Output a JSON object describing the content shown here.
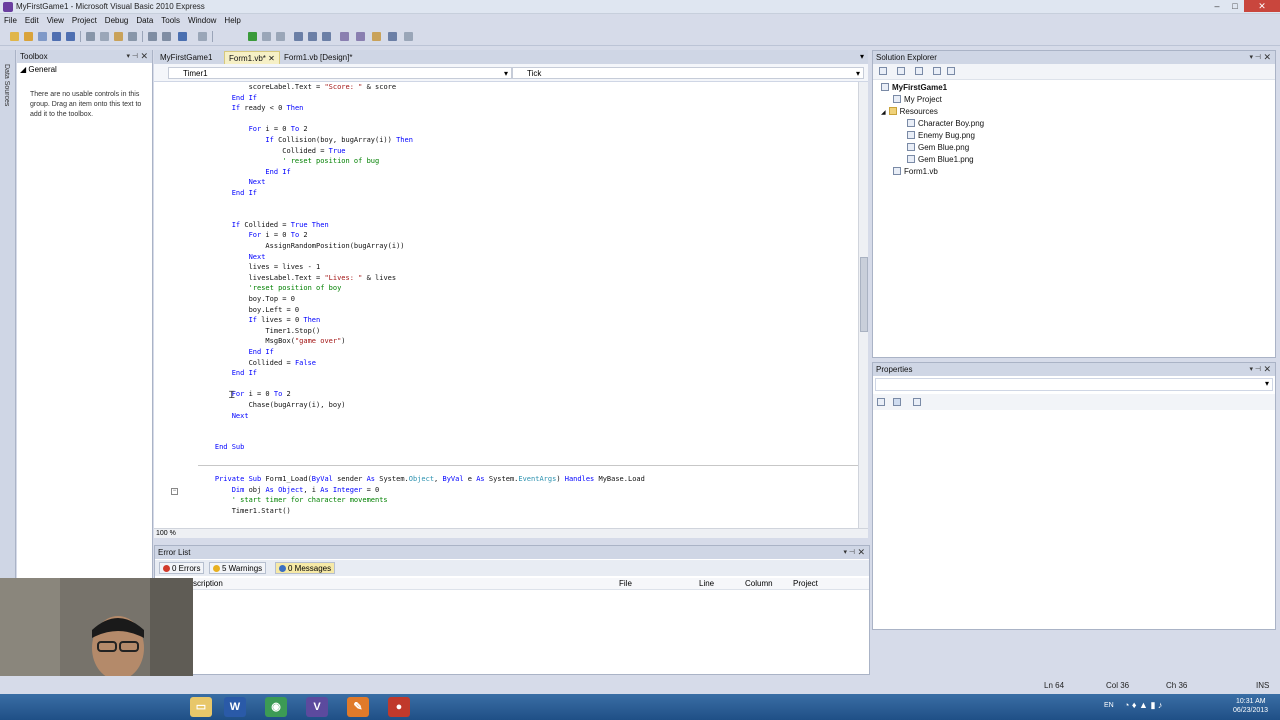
{
  "window": {
    "title": "MyFirstGame1 - Microsoft Visual Basic 2010 Express"
  },
  "menu": [
    "File",
    "Edit",
    "View",
    "Project",
    "Debug",
    "Data",
    "Tools",
    "Window",
    "Help"
  ],
  "left_strip": {
    "label": "Data Sources"
  },
  "toolbox": {
    "title": "Toolbox",
    "group": "General",
    "message": "There are no usable controls in this group. Drag an item onto this text to add it to the toolbox."
  },
  "doc_tabs": [
    "MyFirstGame1",
    "Form1.vb*",
    "Form1.vb [Design]*"
  ],
  "nav": {
    "object": "Timer1",
    "member": "Tick"
  },
  "code_lines": [
    {
      "t": "            scoreLabel.Text = ",
      "s": "\"Score: \"",
      "r": " & score"
    },
    {
      "k": "        End If"
    },
    {
      "k": "        If",
      "t": " ready < 0 ",
      "k2": "Then"
    },
    {
      "b": ""
    },
    {
      "k": "            For",
      "t": " i = 0 ",
      "k2": "To",
      "r": " 2"
    },
    {
      "k": "                If",
      "t": " Collision(boy, bugArray(i)) ",
      "k2": "Then"
    },
    {
      "t": "                    Collided = ",
      "k2": "True"
    },
    {
      "c": "                    ' reset position of bug"
    },
    {
      "k": "                End If"
    },
    {
      "k": "            Next"
    },
    {
      "k": "        End If"
    },
    {
      "b": ""
    },
    {
      "b": ""
    },
    {
      "k": "        If",
      "t": " Collided = ",
      "k2": "True Then"
    },
    {
      "k": "            For",
      "t": " i = 0 ",
      "k2": "To",
      "r": " 2"
    },
    {
      "t": "                AssignRandomPosition(bugArray(i))"
    },
    {
      "k": "            Next"
    },
    {
      "t": "            lives = lives - 1"
    },
    {
      "t": "            livesLabel.Text = ",
      "s": "\"Lives: \"",
      "r": " & lives"
    },
    {
      "c": "            'reset position of boy"
    },
    {
      "t": "            boy.Top = 0"
    },
    {
      "t": "            boy.Left = 0"
    },
    {
      "k": "            If",
      "t": " lives = 0 ",
      "k2": "Then"
    },
    {
      "t": "                Timer1.Stop()"
    },
    {
      "t": "                MsgBox(",
      "s": "\"game over\"",
      "r": ")"
    },
    {
      "k": "            End If"
    },
    {
      "t": "            Collided = ",
      "k2": "False"
    },
    {
      "k": "        End If"
    },
    {
      "b": ""
    },
    {
      "k": "        For",
      "t": " i = 0 ",
      "k2": "To",
      "r": " 2"
    },
    {
      "t": "            Chase(bugArray(i), boy)"
    },
    {
      "k": "        Next"
    },
    {
      "b": ""
    },
    {
      "b": ""
    },
    {
      "k": "    End Sub"
    },
    {
      "b": ""
    },
    {
      "b": ""
    },
    {
      "k": "    Private Sub",
      "t": " Form1_Load(",
      "k2": "ByVal",
      "r": " sender ",
      "k3": "As",
      "r2": " System.",
      "ty": "Object",
      "r3": ", ",
      "k4": "ByVal",
      "r4": " e ",
      "k5": "As",
      "r5": " System.",
      "ty2": "EventArgs",
      "r6": ") ",
      "k6": "Handles",
      "r7": " MyBase.Load"
    },
    {
      "k": "        Dim",
      "t": " obj ",
      "k2": "As Object",
      "r": ", i ",
      "k3": "As Integer",
      "r2": " = 0"
    },
    {
      "c": "        ' start timer for character movements"
    },
    {
      "t": "        Timer1.Start()"
    }
  ],
  "editor": {
    "zoom": "100 %"
  },
  "solution_explorer": {
    "title": "Solution Explorer",
    "project": "MyFirstGame1",
    "items": [
      "My Project",
      "Resources",
      "Character Boy.png",
      "Enemy Bug.png",
      "Gem Blue.png",
      "Gem Blue1.png",
      "Form1.vb"
    ]
  },
  "properties": {
    "title": "Properties"
  },
  "error_list": {
    "title": "Error List",
    "errors": "0 Errors",
    "warnings": "5 Warnings",
    "messages": "0 Messages",
    "columns": [
      "scription",
      "File",
      "Line",
      "Column",
      "Project"
    ]
  },
  "status": {
    "ln": "Ln 64",
    "col": "Col 36",
    "ch": "Ch 36",
    "ins": "INS"
  },
  "taskbar": {
    "lang": "EN",
    "time": "10:31 AM",
    "date": "06/23/2013"
  },
  "colors": {
    "keyword": "#0000ff",
    "string": "#a31515",
    "comment": "#008000",
    "type": "#2b91af"
  }
}
